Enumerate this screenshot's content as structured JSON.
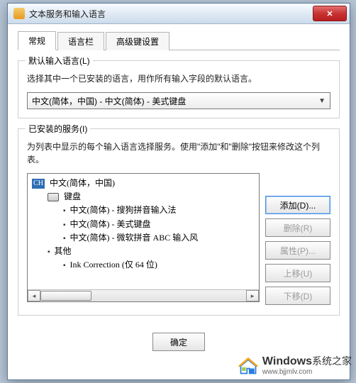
{
  "window": {
    "title": "文本服务和输入语言"
  },
  "tabs": {
    "items": [
      {
        "label": "常规"
      },
      {
        "label": "语言栏"
      },
      {
        "label": "高级键设置"
      }
    ]
  },
  "default_lang": {
    "legend": "默认输入语言(L)",
    "desc": "选择其中一个已安装的语言，用作所有输入字段的默认语言。",
    "combo_value": "中文(简体，中国) - 中文(简体) - 美式键盘"
  },
  "services": {
    "legend": "已安装的服务(I)",
    "desc": "为列表中显示的每个输入语言选择服务。使用\"添加\"和\"删除\"按钮来修改这个列表。",
    "lang_badge": "CH",
    "lang_name": "中文(简体，中国)",
    "kb_label": "键盘",
    "kb_items": [
      "中文(简体) - 搜狗拼音输入法",
      "中文(简体) - 美式键盘",
      "中文(简体) - 微软拼音 ABC 输入风"
    ],
    "other_label": "其他",
    "other_items": [
      "Ink Correction (仅 64 位)"
    ]
  },
  "buttons": {
    "add": "添加(D)...",
    "remove": "删除(R)",
    "props": "属性(P)...",
    "up": "上移(U)",
    "down": "下移(D)"
  },
  "footer": {
    "ok": "确定"
  },
  "watermark": {
    "brand": "Windows",
    "sub_cn": "系统之家",
    "url": "www.bjjmlv.com"
  }
}
